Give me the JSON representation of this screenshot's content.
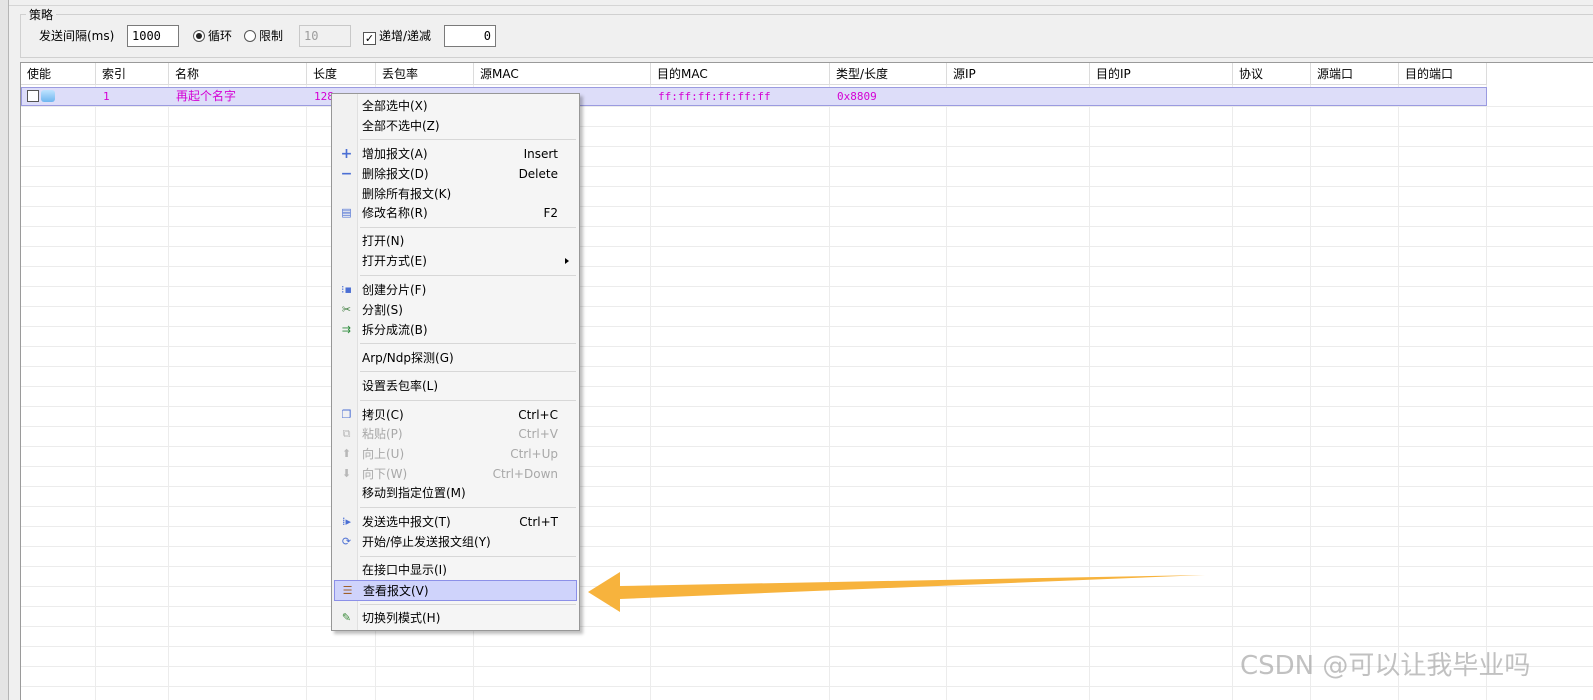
{
  "strategy": {
    "title": "策略",
    "interval_label": "发送间隔(ms)",
    "interval_value": "1000",
    "loop_label": "循环",
    "limit_label": "限制",
    "limit_value": "10",
    "incdec_label": "递增/递减",
    "incdec_value": "0"
  },
  "table": {
    "columns": [
      "使能",
      "索引",
      "名称",
      "长度",
      "丢包率",
      "源MAC",
      "目的MAC",
      "类型/长度",
      "源IP",
      "目的IP",
      "协议",
      "源端口",
      "目的端口"
    ],
    "row": {
      "index": "1",
      "name": "再起个名字",
      "length": "128",
      "dst_mac": "ff:ff:ff:ff:ff:ff",
      "type": "0x8809"
    }
  },
  "menu": {
    "items": [
      {
        "label": "全部选中(X)",
        "shortcut": ""
      },
      {
        "label": "全部不选中(Z)",
        "shortcut": ""
      },
      {
        "label": "增加报文(A)",
        "shortcut": "Insert"
      },
      {
        "label": "删除报文(D)",
        "shortcut": "Delete"
      },
      {
        "label": "删除所有报文(K)",
        "shortcut": ""
      },
      {
        "label": "修改名称(R)",
        "shortcut": "F2"
      },
      {
        "label": "打开(N)",
        "shortcut": ""
      },
      {
        "label": "打开方式(E)",
        "shortcut": ""
      },
      {
        "label": "创建分片(F)",
        "shortcut": ""
      },
      {
        "label": "分割(S)",
        "shortcut": ""
      },
      {
        "label": "拆分成流(B)",
        "shortcut": ""
      },
      {
        "label": "Arp/Ndp探测(G)",
        "shortcut": ""
      },
      {
        "label": "设置丢包率(L)",
        "shortcut": ""
      },
      {
        "label": "拷贝(C)",
        "shortcut": "Ctrl+C"
      },
      {
        "label": "粘贴(P)",
        "shortcut": "Ctrl+V"
      },
      {
        "label": "向上(U)",
        "shortcut": "Ctrl+Up"
      },
      {
        "label": "向下(W)",
        "shortcut": "Ctrl+Down"
      },
      {
        "label": "移动到指定位置(M)",
        "shortcut": ""
      },
      {
        "label": "发送选中报文(T)",
        "shortcut": "Ctrl+T"
      },
      {
        "label": "开始/停止发送报文组(Y)",
        "shortcut": ""
      },
      {
        "label": "在接口中显示(I)",
        "shortcut": ""
      },
      {
        "label": "查看报文(V)",
        "shortcut": ""
      },
      {
        "label": "切换列模式(H)",
        "shortcut": ""
      }
    ]
  },
  "watermark": "CSDN @可以让我毕业吗",
  "colors": {
    "row_text": "#d400d4",
    "row_bg": "#ddddf9",
    "highlight": "#cfd3fb",
    "arrow": "#f7b33d"
  }
}
